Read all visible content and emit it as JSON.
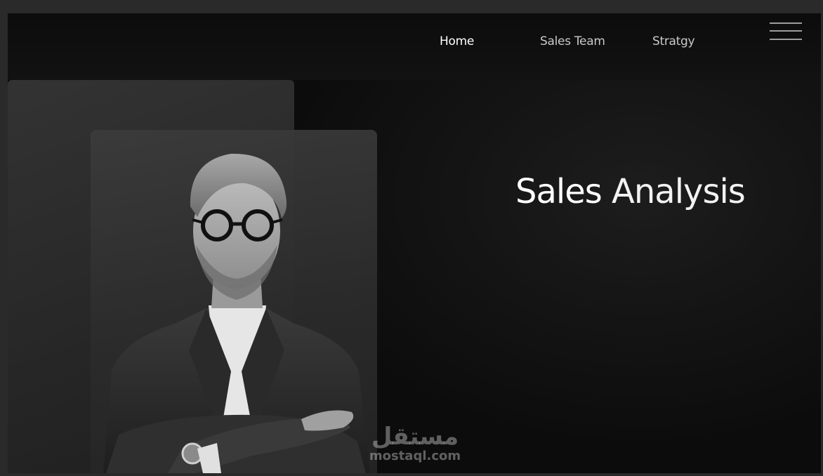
{
  "nav": {
    "items": [
      {
        "label": "Home",
        "active": true
      },
      {
        "label": "Sales Team",
        "active": false
      },
      {
        "label": "Stratgy",
        "active": false
      }
    ],
    "menu_icon": "hamburger-menu-icon"
  },
  "hero": {
    "title_strong": "Sales",
    "title_light": "Analysis",
    "image": "businessman-portrait"
  },
  "watermark": {
    "arabic": "مستقل",
    "latin": "mostaql.com"
  },
  "colors": {
    "background": "#121212",
    "panel": "#2e2e2e",
    "text_active": "#ffffff",
    "text_muted": "#c9c9c9"
  }
}
